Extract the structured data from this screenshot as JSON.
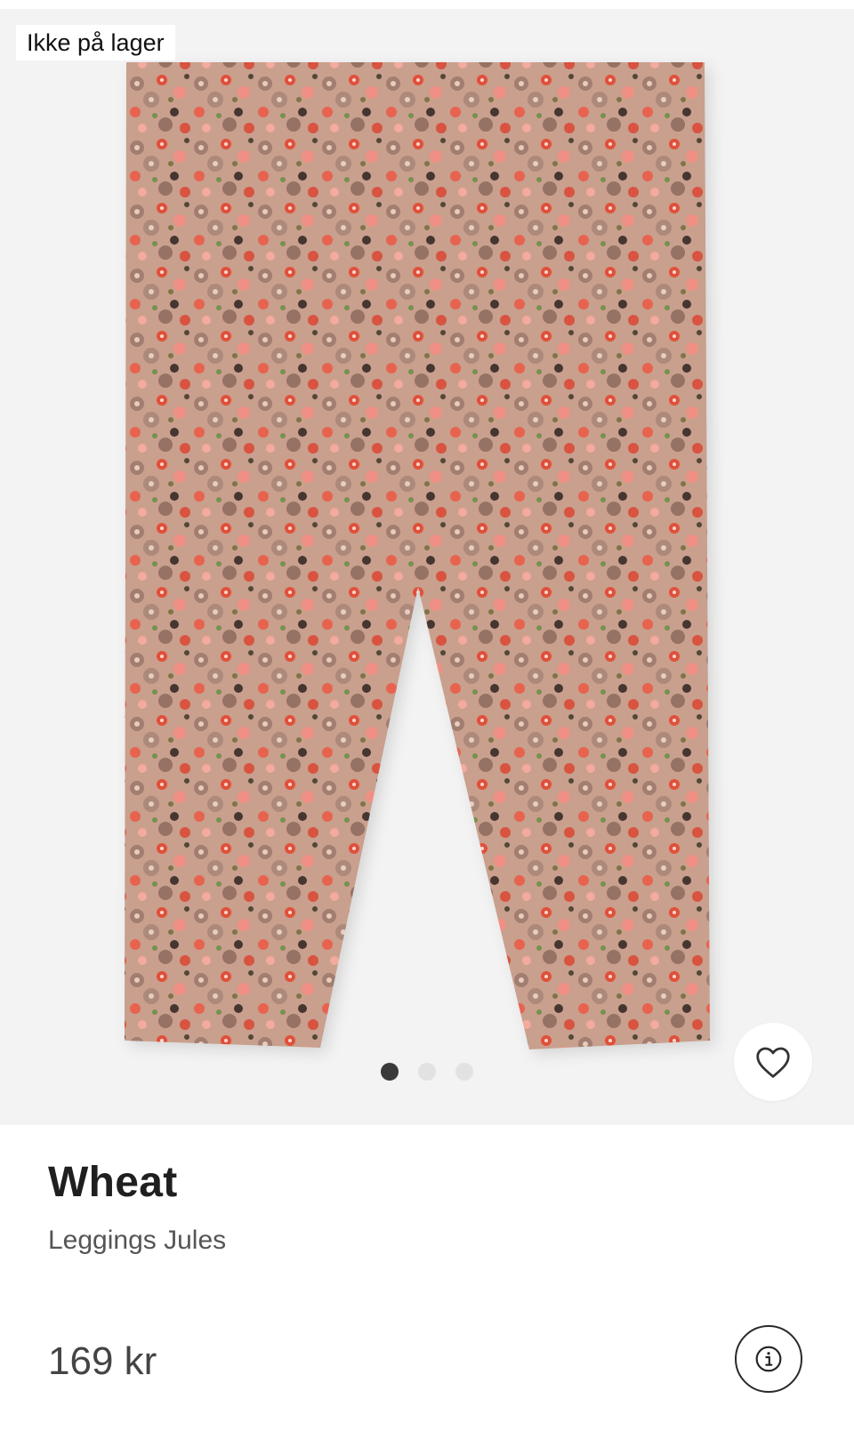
{
  "product": {
    "stock_status": "Ikke på lager",
    "brand": "Wheat",
    "name": "Leggings Jules",
    "price": "169 kr"
  },
  "gallery": {
    "image_count": 3,
    "active_index": 0
  },
  "icons": {
    "favorite": "heart-outline-icon",
    "info": "info-circle-icon"
  },
  "colors": {
    "image_background": "#f3f3f3",
    "fabric_base": "#b8826e",
    "flower_red": "#e0452f",
    "flower_pink": "#f08a7e",
    "dot_active": "#3a3a3a",
    "dot_inactive": "#e2e2e2"
  }
}
